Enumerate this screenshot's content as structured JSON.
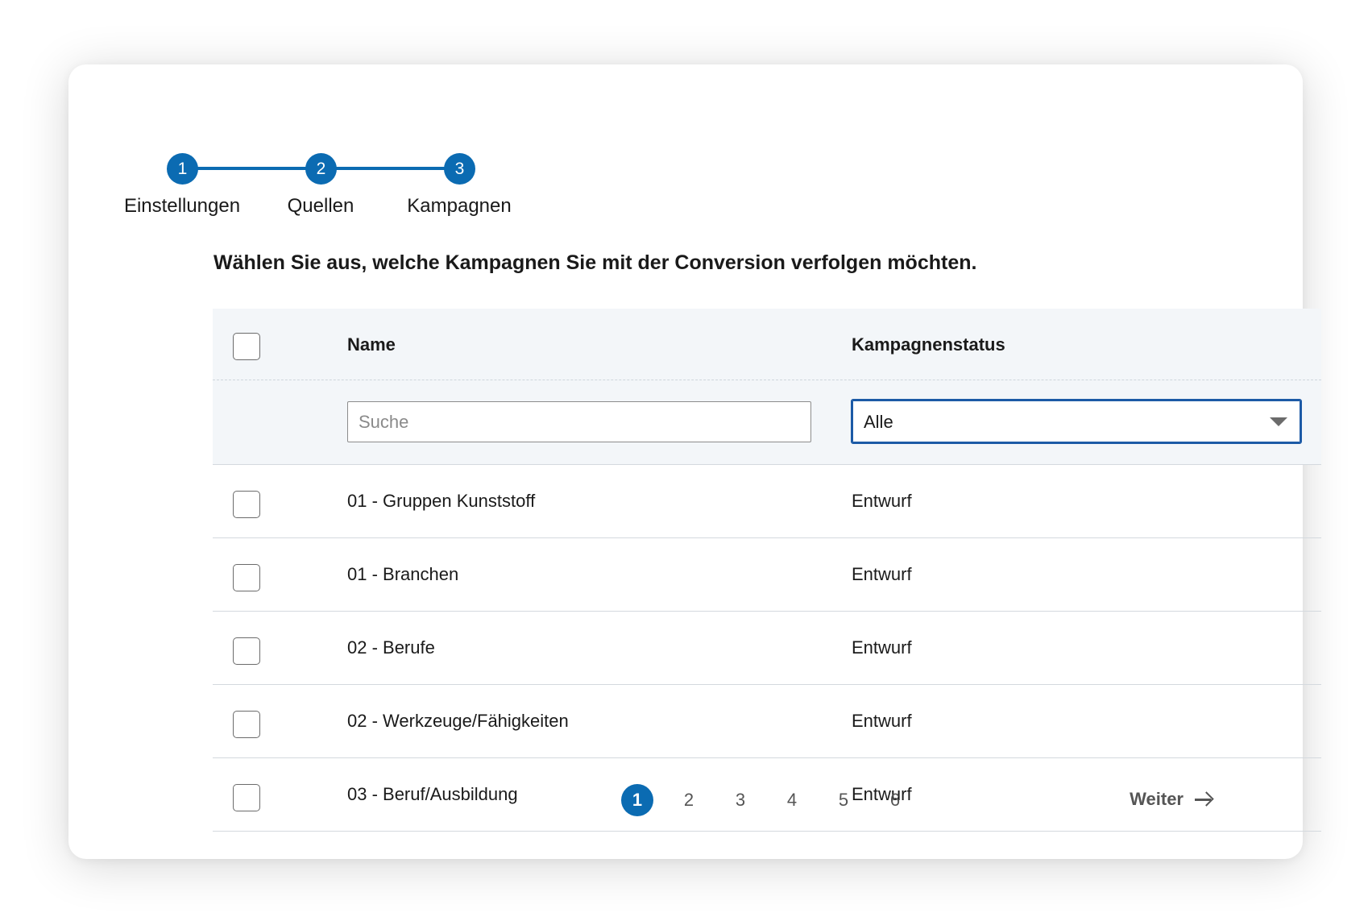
{
  "stepper": {
    "steps": [
      {
        "number": "1",
        "label": "Einstellungen"
      },
      {
        "number": "2",
        "label": "Quellen"
      },
      {
        "number": "3",
        "label": "Kampagnen"
      }
    ]
  },
  "instruction": "Wählen Sie aus, welche Kampagnen Sie mit der Conversion verfolgen möchten.",
  "table": {
    "columns": {
      "name": "Name",
      "status": "Kampagnenstatus"
    },
    "filters": {
      "search_placeholder": "Suche",
      "status_selected": "Alle"
    },
    "rows": [
      {
        "name": "01 - Gruppen Kunststoff",
        "status": "Entwurf"
      },
      {
        "name": "01 - Branchen",
        "status": "Entwurf"
      },
      {
        "name": "02 - Berufe",
        "status": "Entwurf"
      },
      {
        "name": "02 - Werkzeuge/Fähigkeiten",
        "status": "Entwurf"
      },
      {
        "name": "03 - Beruf/Ausbildung",
        "status": "Entwurf"
      }
    ]
  },
  "pagination": {
    "pages": [
      "1",
      "2",
      "3",
      "4",
      "5",
      "6"
    ],
    "current": "1",
    "next_label": "Weiter"
  },
  "colors": {
    "accent": "#0b6bb2",
    "select_border": "#1c5aa6"
  }
}
